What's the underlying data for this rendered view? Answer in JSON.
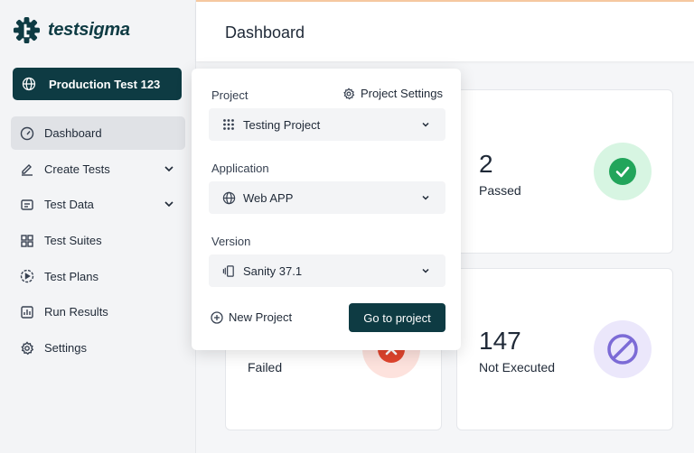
{
  "app": {
    "name": "testsigma"
  },
  "environment": {
    "label": "Production Test 123"
  },
  "sidebar": {
    "items": [
      {
        "label": "Dashboard",
        "icon": "gauge-icon"
      },
      {
        "label": "Create Tests",
        "icon": "pencil-icon"
      },
      {
        "label": "Test Data",
        "icon": "folder-icon"
      },
      {
        "label": "Test Suites",
        "icon": "grid-icon"
      },
      {
        "label": "Test Plans",
        "icon": "play-circle-icon"
      },
      {
        "label": "Run Results",
        "icon": "chart-icon"
      },
      {
        "label": "Settings",
        "icon": "gear-icon"
      }
    ]
  },
  "header": {
    "title": "Dashboard"
  },
  "cards": {
    "passed": {
      "value": "2",
      "label": "Passed",
      "color": "#22a55b"
    },
    "failed": {
      "label": "Failed",
      "color": "#e0442d"
    },
    "not_executed": {
      "value": "147",
      "label": "Not Executed",
      "color": "#7c6bd6"
    }
  },
  "popup": {
    "project_label": "Project",
    "project_settings": "Project Settings",
    "project_value": "Testing Project",
    "application_label": "Application",
    "application_value": "Web APP",
    "version_label": "Version",
    "version_value": "Sanity 37.1",
    "new_project": "New Project",
    "go_to_project": "Go to project"
  },
  "colors": {
    "brand": "#0e3b43"
  }
}
